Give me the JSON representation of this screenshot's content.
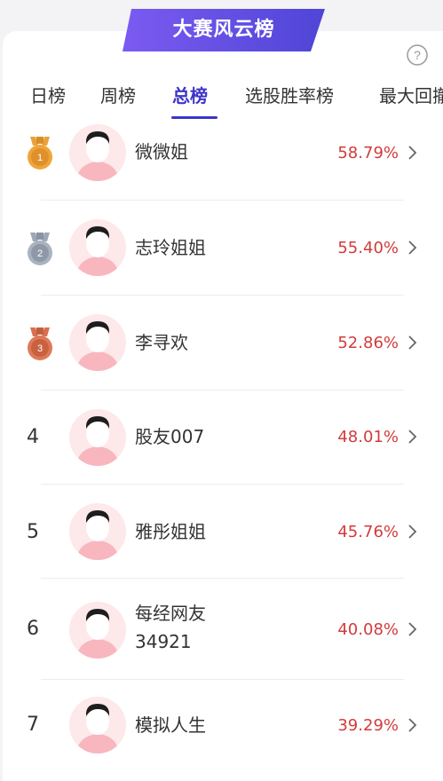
{
  "header": {
    "title": "大赛风云榜"
  },
  "tabs": [
    {
      "label": "日榜",
      "active": false
    },
    {
      "label": "周榜",
      "active": false
    },
    {
      "label": "总榜",
      "active": true
    },
    {
      "label": "选股胜率榜",
      "active": false
    },
    {
      "label": "最大回撤",
      "active": false
    }
  ],
  "rows": [
    {
      "rank": "1",
      "medal": "gold-medal-icon",
      "name": "微微姐",
      "name2": "",
      "rate": "58.79%"
    },
    {
      "rank": "2",
      "medal": "silver-medal-icon",
      "name": "志玲姐姐",
      "name2": "",
      "rate": "55.40%"
    },
    {
      "rank": "3",
      "medal": "bronze-medal-icon",
      "name": "李寻欢",
      "name2": "",
      "rate": "52.86%"
    },
    {
      "rank": "4",
      "name": "股友007",
      "name2": "",
      "rate": "48.01%"
    },
    {
      "rank": "5",
      "name": "雅彤姐姐",
      "name2": "",
      "rate": "45.76%"
    },
    {
      "rank": "6",
      "name": "每经网友",
      "name2": "34921",
      "rate": "40.08%"
    },
    {
      "rank": "7",
      "name": "模拟人生",
      "name2": "",
      "rate": "39.29%"
    }
  ],
  "colors": {
    "accent": "#3d35c8",
    "rate": "#d23b3b",
    "gold": "#e9a23b",
    "silver": "#9ea8b5",
    "bronze": "#d77050"
  }
}
